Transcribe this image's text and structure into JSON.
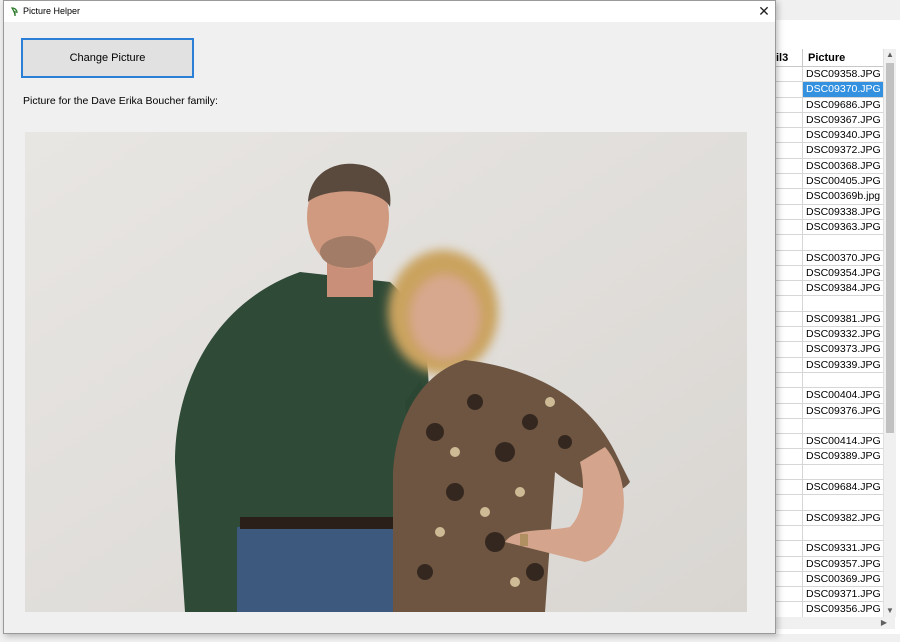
{
  "window": {
    "title": "Picture Helper"
  },
  "dialog": {
    "button_label": "Change Picture",
    "caption": "Picture for the Dave  Erika Boucher family:"
  },
  "grid": {
    "partial_header": "il3",
    "header": "Picture",
    "selected_index": 1,
    "rows": [
      "DSC09358.JPG",
      "DSC09370.JPG",
      "DSC09686.JPG",
      "DSC09367.JPG",
      "DSC09340.JPG",
      "DSC09372.JPG",
      "DSC00368.JPG",
      "DSC00405.JPG",
      "DSC00369b.jpg",
      "DSC09338.JPG",
      "DSC09363.JPG",
      "",
      "DSC00370.JPG",
      "DSC09354.JPG",
      "DSC09384.JPG",
      "",
      "DSC09381.JPG",
      "DSC09332.JPG",
      "DSC09373.JPG",
      "DSC09339.JPG",
      "",
      "DSC00404.JPG",
      "DSC09376.JPG",
      "",
      "DSC00414.JPG",
      "DSC09389.JPG",
      "",
      "DSC09684.JPG",
      "",
      "DSC09382.JPG",
      "",
      "DSC09331.JPG",
      "DSC09357.JPG",
      "DSC00369.JPG",
      "DSC09371.JPG",
      "DSC09356.JPG"
    ]
  }
}
